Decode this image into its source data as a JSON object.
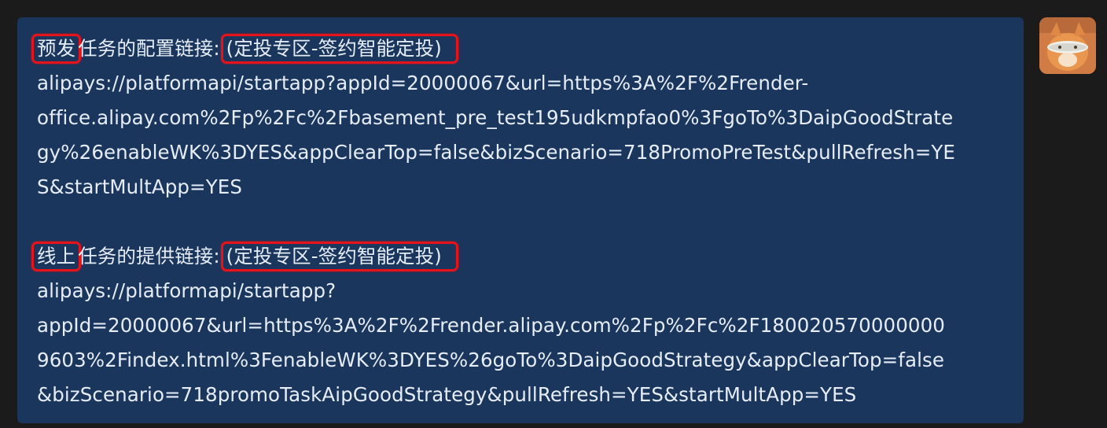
{
  "message": {
    "section1": {
      "tag": "预发",
      "label": "任务的配置链接:",
      "badge": "(定投专区-签约智能定投)",
      "url_lines": [
        "alipays://platformapi/startapp?appId=20000067&url=https%3A%2F%2Frender-",
        "office.alipay.com%2Fp%2Fc%2Fbasement_pre_test195udkmpfao0%3FgoTo%3DaipGoodStrate",
        "gy%26enableWK%3DYES&appClearTop=false&bizScenario=718PromoPreTest&pullRefresh=YE",
        "S&startMultApp=YES"
      ]
    },
    "section2": {
      "tag": "线上",
      "label": "任务的提供链接:",
      "badge": "(定投专区-签约智能定投)",
      "url_lines": [
        "alipays://platformapi/startapp?",
        "appId=20000067&url=https%3A%2F%2Frender.alipay.com%2Fp%2Fc%2F180020570000000",
        "9603%2Findex.html%3FenableWK%3DYES%26goTo%3DaipGoodStrategy&appClearTop=false",
        "&bizScenario=718promoTaskAipGoodStrategy&pullRefresh=YES&startMultApp=YES"
      ]
    }
  },
  "colors": {
    "bubble": "#1a365d",
    "highlight": "#e8121a",
    "text": "#e6edf6",
    "background": "#1b1b1c"
  },
  "avatar": {
    "icon": "cat-avatar-icon"
  }
}
